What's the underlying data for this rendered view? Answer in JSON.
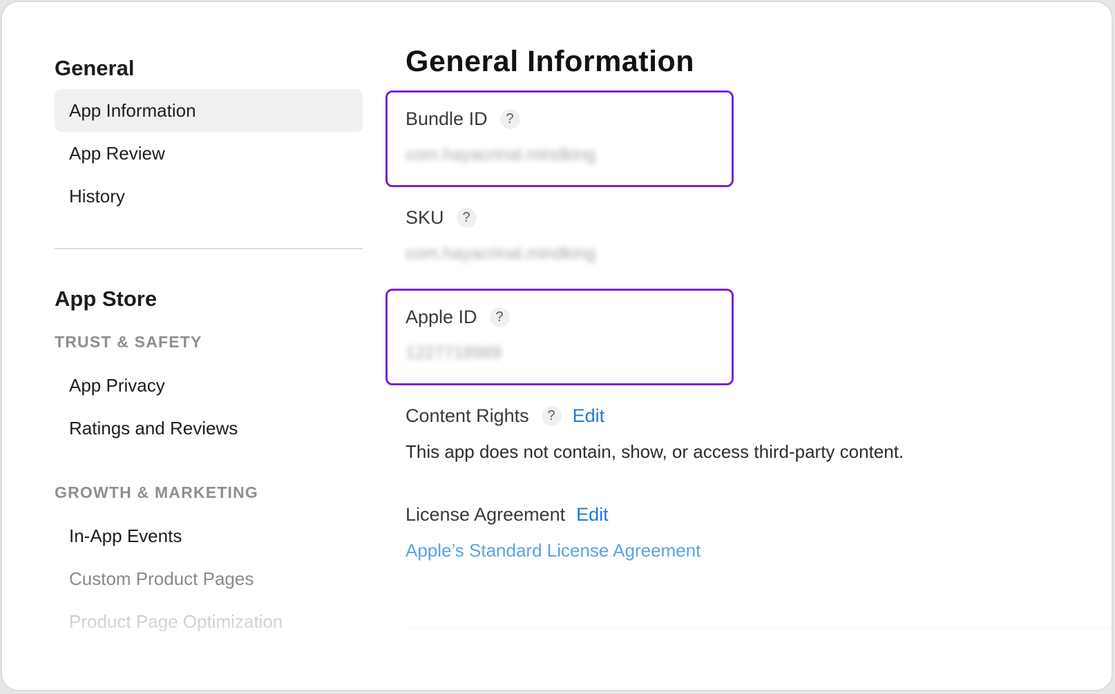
{
  "sidebar": {
    "general_title": "General",
    "general_items": [
      {
        "label": "App Information"
      },
      {
        "label": "App Review"
      },
      {
        "label": "History"
      }
    ],
    "app_store_title": "App Store",
    "trust_safety_label": "TRUST & SAFETY",
    "trust_items": [
      {
        "label": "App Privacy"
      },
      {
        "label": "Ratings and Reviews"
      }
    ],
    "growth_label": "GROWTH & MARKETING",
    "growth_items": [
      {
        "label": "In-App Events"
      },
      {
        "label": "Custom Product Pages"
      },
      {
        "label": "Product Page Optimization"
      }
    ]
  },
  "main": {
    "title": "General Information",
    "bundle_id": {
      "label": "Bundle ID",
      "help": "?",
      "value": "com.hayacrinal.mindking"
    },
    "sku": {
      "label": "SKU",
      "help": "?",
      "value": "com.hayacrinal.mindking"
    },
    "apple_id": {
      "label": "Apple ID",
      "help": "?",
      "value": "1227718989"
    },
    "content_rights": {
      "label": "Content Rights",
      "help": "?",
      "edit": "Edit",
      "value": "This app does not contain, show, or access third-party content."
    },
    "license": {
      "label": "License Agreement",
      "edit": "Edit",
      "link": "Apple’s Standard License Agreement"
    }
  },
  "colors": {
    "highlight": "#7a1fd6",
    "link": "#1e7ad6",
    "selected_bg": "#f0f0f1"
  }
}
